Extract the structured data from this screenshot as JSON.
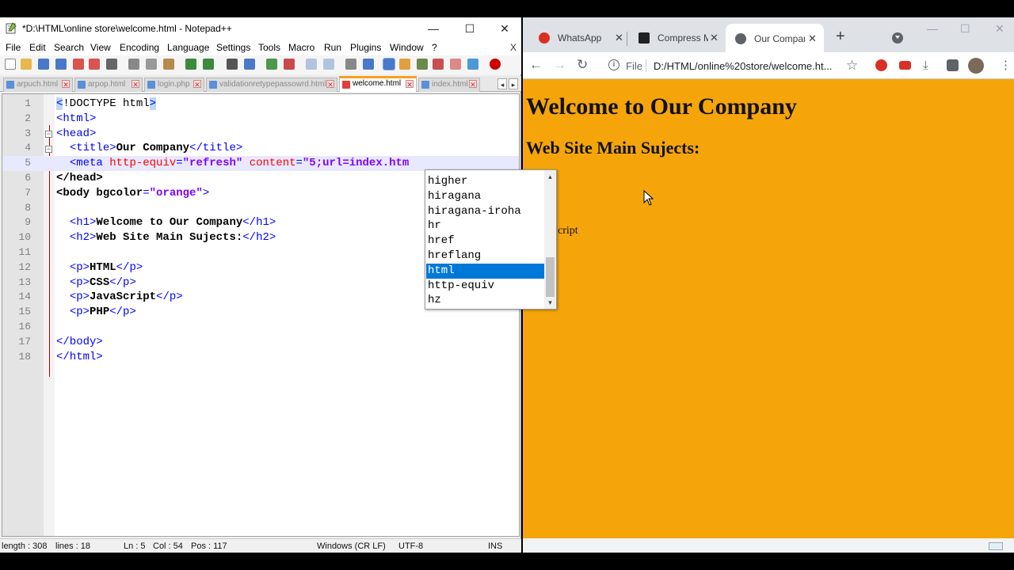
{
  "notepad": {
    "title": "*D:\\HTML\\online store\\welcome.html - Notepad++",
    "window_buttons": {
      "minimize": "—",
      "maximize": "☐",
      "close": "✕"
    },
    "menu": [
      "File",
      "Edit",
      "Search",
      "View",
      "Encoding",
      "Language",
      "Settings",
      "Tools",
      "Macro",
      "Run",
      "Plugins",
      "Window",
      "?"
    ],
    "menu_close": "X",
    "tabs": [
      {
        "label": "arpuch.html",
        "active": false
      },
      {
        "label": "arpop.html",
        "active": false
      },
      {
        "label": "login.php",
        "active": false
      },
      {
        "label": "validationretypepassowrd.html",
        "active": false
      },
      {
        "label": "welcome.html",
        "active": true
      },
      {
        "label": "index.html",
        "active": false
      }
    ],
    "tab_nav": {
      "left": "◂",
      "right": "▸"
    },
    "lines": [
      {
        "num": "1",
        "segs": [
          {
            "c": "hl t",
            "t": "<"
          },
          {
            "c": "d",
            "t": "!DOCTYPE html"
          },
          {
            "c": "hl t",
            "t": ">"
          }
        ]
      },
      {
        "num": "2",
        "segs": [
          {
            "c": "t",
            "t": "<html>"
          }
        ]
      },
      {
        "num": "3",
        "segs": [
          {
            "c": "t",
            "t": "<head>"
          }
        ]
      },
      {
        "num": "4",
        "segs": [
          {
            "c": "d",
            "t": "  "
          },
          {
            "c": "t",
            "t": "<title>"
          },
          {
            "c": "x",
            "t": "Our Company"
          },
          {
            "c": "t",
            "t": "</title>"
          }
        ]
      },
      {
        "num": "5",
        "segs": [
          {
            "c": "d",
            "t": "  "
          },
          {
            "c": "t",
            "t": "<meta "
          },
          {
            "c": "a",
            "t": "http-equiv"
          },
          {
            "c": "t",
            "t": "="
          },
          {
            "c": "v",
            "t": "\"refresh\""
          },
          {
            "c": "t",
            "t": " "
          },
          {
            "c": "a",
            "t": "content"
          },
          {
            "c": "t",
            "t": "="
          },
          {
            "c": "v",
            "t": "\"5;url=index.htm"
          }
        ]
      },
      {
        "num": "6",
        "segs": [
          {
            "c": "t x",
            "t": "</head>"
          }
        ]
      },
      {
        "num": "7",
        "segs": [
          {
            "c": "t x",
            "t": "<body "
          },
          {
            "c": "a x",
            "t": "bgcolor"
          },
          {
            "c": "t",
            "t": "="
          },
          {
            "c": "v",
            "t": "\"orange\""
          },
          {
            "c": "t",
            "t": ">"
          }
        ]
      },
      {
        "num": "8",
        "segs": []
      },
      {
        "num": "9",
        "segs": [
          {
            "c": "d",
            "t": "  "
          },
          {
            "c": "t",
            "t": "<h1>"
          },
          {
            "c": "x",
            "t": "Welcome to Our Company"
          },
          {
            "c": "t",
            "t": "</h1>"
          }
        ]
      },
      {
        "num": "10",
        "segs": [
          {
            "c": "d",
            "t": "  "
          },
          {
            "c": "t",
            "t": "<h2>"
          },
          {
            "c": "x",
            "t": "Web Site Main Sujects:"
          },
          {
            "c": "t",
            "t": "</h2>"
          }
        ]
      },
      {
        "num": "11",
        "segs": []
      },
      {
        "num": "12",
        "segs": [
          {
            "c": "d",
            "t": "  "
          },
          {
            "c": "t",
            "t": "<p>"
          },
          {
            "c": "x",
            "t": "HTML"
          },
          {
            "c": "t",
            "t": "</p>"
          }
        ]
      },
      {
        "num": "13",
        "segs": [
          {
            "c": "d",
            "t": "  "
          },
          {
            "c": "t",
            "t": "<p>"
          },
          {
            "c": "x",
            "t": "CSS"
          },
          {
            "c": "t",
            "t": "</p>"
          }
        ]
      },
      {
        "num": "14",
        "segs": [
          {
            "c": "d",
            "t": "  "
          },
          {
            "c": "t",
            "t": "<p>"
          },
          {
            "c": "x",
            "t": "JavaScript"
          },
          {
            "c": "t",
            "t": "</p>"
          }
        ]
      },
      {
        "num": "15",
        "segs": [
          {
            "c": "d",
            "t": "  "
          },
          {
            "c": "t",
            "t": "<p>"
          },
          {
            "c": "x",
            "t": "PHP"
          },
          {
            "c": "t",
            "t": "</p>"
          }
        ]
      },
      {
        "num": "16",
        "segs": []
      },
      {
        "num": "17",
        "segs": [
          {
            "c": "t",
            "t": "</body>"
          }
        ]
      },
      {
        "num": "18",
        "segs": [
          {
            "c": "t",
            "t": "</html>"
          }
        ]
      }
    ],
    "autocomplete": {
      "items": [
        "higher",
        "hiragana",
        "hiragana-iroha",
        "hr",
        "href",
        "hreflang",
        "html",
        "http-equiv",
        "hz"
      ],
      "selected": "html",
      "scroll_up": "▴",
      "scroll_down": "▾"
    },
    "status": {
      "length": "length : 308",
      "lines": "lines : 18",
      "ln": "Ln : 5",
      "col": "Col : 54",
      "pos": "Pos : 117",
      "eol": "Windows (CR LF)",
      "encoding": "UTF-8",
      "mode": "INS"
    },
    "hscroll": {
      "left": "<",
      "right": ">"
    }
  },
  "chrome": {
    "tabs": [
      {
        "label": "WhatsApp",
        "favicon_color": "#d93025",
        "active": false
      },
      {
        "label": "Compress Mi",
        "favicon_color": "#202124",
        "active": false
      },
      {
        "label": "Our Compan",
        "favicon_color": "#5f6368",
        "active": true
      }
    ],
    "tab_close": "✕",
    "new_tab": "+",
    "window_buttons": {
      "minimize": "—",
      "maximize": "☐",
      "close": "✕"
    },
    "nav": {
      "back": "←",
      "forward": "→",
      "reload": "↻"
    },
    "omnibox": {
      "info": "i",
      "scheme": "File",
      "url": "D:/HTML/online%20store/welcome.ht...",
      "star": "☆"
    },
    "page": {
      "bg_color": "#f5a50a",
      "h1": "Welcome to Our Company",
      "h2": "Web Site Main Sujects:",
      "frag_1": "·",
      "frag_2": "cript"
    }
  }
}
